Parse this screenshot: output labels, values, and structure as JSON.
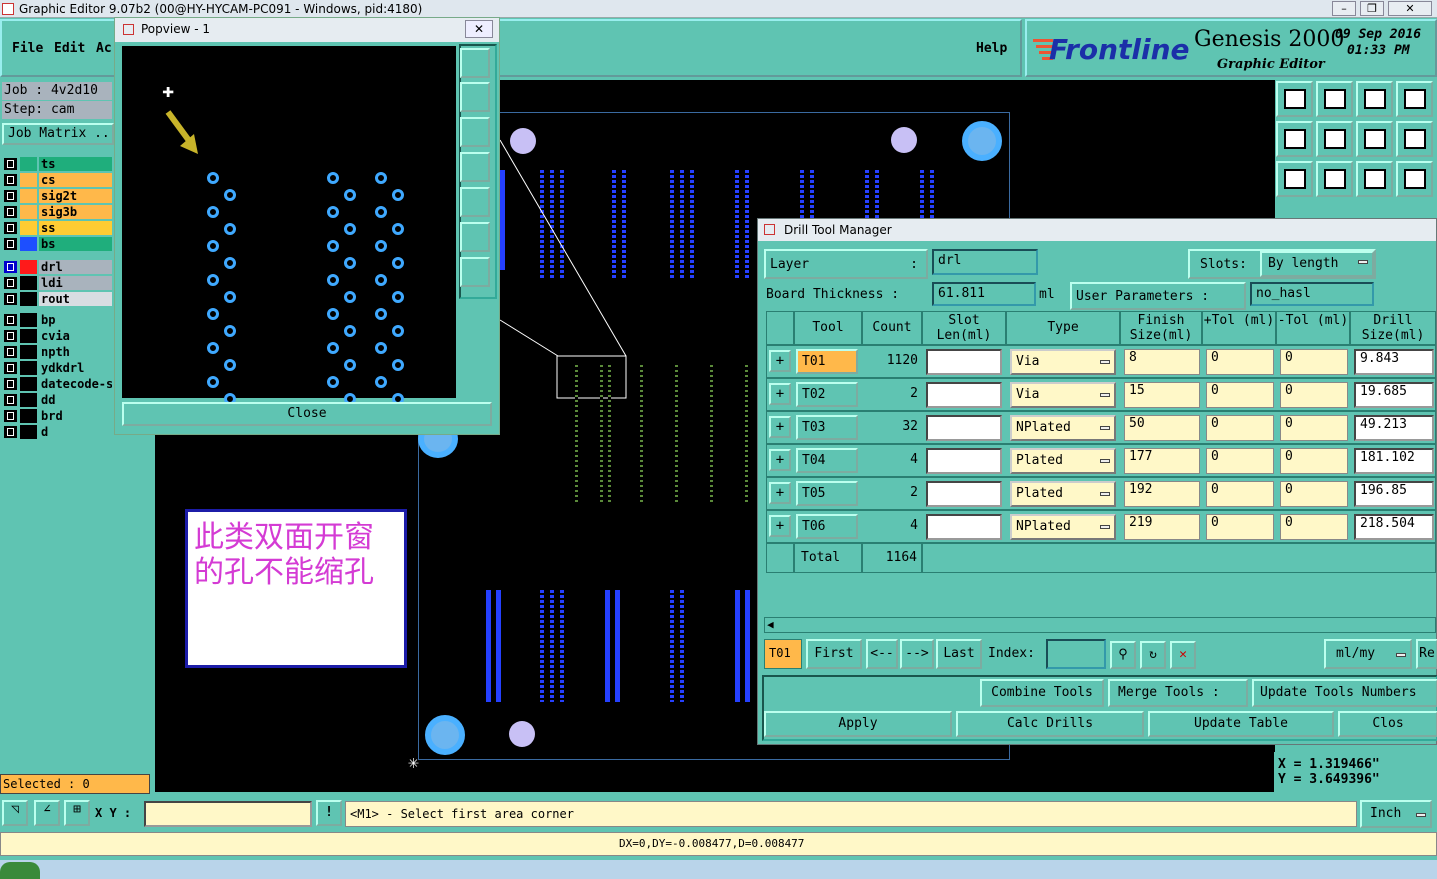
{
  "window": {
    "title": "Graphic Editor 9.07b2 (00@HY-HYCAM-PC091 - Windows, pid:4180)"
  },
  "menu": {
    "file": "File",
    "edit": "Edit",
    "actions": "Ac",
    "help": "Help"
  },
  "brand": {
    "logo": "Frontline",
    "product": "Genesis 2000",
    "subtitle": "Graphic Editor",
    "date": "09 Sep 2016",
    "time": "01:33 PM"
  },
  "job": {
    "job_label": "Job : 4v2d10",
    "step_label": "Step: cam",
    "matrix_button": "Job Matrix ..."
  },
  "layers": [
    {
      "name": "ts",
      "color": "#1fae7c",
      "swatch": "#1fae7c",
      "icon": "#000"
    },
    {
      "name": "cs",
      "color": "#ffb84a",
      "swatch": "#ffb84a",
      "icon": "#000"
    },
    {
      "name": "sig2t",
      "color": "#ffb84a",
      "swatch": "#ffb84a",
      "icon": "#000"
    },
    {
      "name": "sig3b",
      "color": "#ffb84a",
      "swatch": "#ffb84a",
      "icon": "#000"
    },
    {
      "name": "ss",
      "color": "#ffcc33",
      "swatch": "#ffcc33",
      "icon": "#000"
    },
    {
      "name": "bs",
      "color": "#1fae7c",
      "swatch": "#1d4fff",
      "icon": "#000"
    },
    {
      "name": "drl",
      "color": "#a9b3bd",
      "swatch": "#ff1a1a",
      "icon": "#0000cc"
    },
    {
      "name": "ldi",
      "color": "#a9b3bd",
      "swatch": "#000",
      "icon": "#000"
    },
    {
      "name": "rout",
      "color": "#d8dde2",
      "swatch": "#000",
      "icon": "#000"
    },
    {
      "name": "bp",
      "color": "#5fc4b2",
      "swatch": "#000",
      "icon": "#000"
    },
    {
      "name": "cvia",
      "color": "#5fc4b2",
      "swatch": "#000",
      "icon": "#000"
    },
    {
      "name": "npth",
      "color": "#5fc4b2",
      "swatch": "#000",
      "icon": "#000"
    },
    {
      "name": "ydkdrl",
      "color": "#5fc4b2",
      "swatch": "#000",
      "icon": "#000"
    },
    {
      "name": "datecode-s",
      "color": "#5fc4b2",
      "swatch": "#000",
      "icon": "#000"
    },
    {
      "name": "dd",
      "color": "#5fc4b2",
      "swatch": "#000",
      "icon": "#000"
    },
    {
      "name": "brd",
      "color": "#5fc4b2",
      "swatch": "#000",
      "icon": "#000"
    },
    {
      "name": "d",
      "color": "#5fc4b2",
      "swatch": "#000",
      "icon": "#000"
    }
  ],
  "popview": {
    "title": "Popview - 1",
    "close_label": "Close"
  },
  "annotation": {
    "text": "此类双面开窗的孔不能缩孔"
  },
  "dtm": {
    "title": "Drill Tool Manager",
    "layer_label": "Layer",
    "layer_value": "drl",
    "slots_label": "Slots:",
    "slots_value": "By length",
    "board_thickness_label": "Board Thickness :",
    "board_thickness_value": "61.811",
    "board_thickness_unit": "ml",
    "user_params_label": "User Parameters :",
    "user_params_value": "no_hasl",
    "headers": {
      "tool": "Tool",
      "count": "Count",
      "slot_len": "Slot Len(ml)",
      "type": "Type",
      "finish": "Finish Size(ml)",
      "ptol": "+Tol (ml)",
      "mtol": "-Tol (ml)",
      "drill": "Drill Size(ml)"
    },
    "rows": [
      {
        "tool": "T01",
        "count": "1120",
        "type": "Via",
        "finish": "8",
        "ptol": "0",
        "mtol": "0",
        "drill": "9.843",
        "selected": true
      },
      {
        "tool": "T02",
        "count": "2",
        "type": "Via",
        "finish": "15",
        "ptol": "0",
        "mtol": "0",
        "drill": "19.685"
      },
      {
        "tool": "T03",
        "count": "32",
        "type": "NPlated",
        "finish": "50",
        "ptol": "0",
        "mtol": "0",
        "drill": "49.213"
      },
      {
        "tool": "T04",
        "count": "4",
        "type": "Plated",
        "finish": "177",
        "ptol": "0",
        "mtol": "0",
        "drill": "181.102"
      },
      {
        "tool": "T05",
        "count": "2",
        "type": "Plated",
        "finish": "192",
        "ptol": "0",
        "mtol": "0",
        "drill": "196.85"
      },
      {
        "tool": "T06",
        "count": "4",
        "type": "NPlated",
        "finish": "219",
        "ptol": "0",
        "mtol": "0",
        "drill": "218.504"
      }
    ],
    "total_label": "Total",
    "total_value": "1164",
    "nav": {
      "current": "T01",
      "first": "First",
      "prev": "<--",
      "next": "-->",
      "last": "Last",
      "index_label": "Index:",
      "units": "ml/my",
      "re": "Re"
    },
    "actions": {
      "combine": "Combine Tools",
      "merge": "Merge Tools :",
      "update_numbers": "Update Tools Numbers",
      "apply": "Apply",
      "calc": "Calc Drills",
      "update_table": "Update Table",
      "close": "Clos"
    }
  },
  "status": {
    "selected": "Selected : 0",
    "xy_label": "X Y :",
    "prompt": "<M1> - Select first area corner",
    "units": "Inch",
    "coord_x": "X = 1.319466\"",
    "coord_y": "Y = 3.649396\"",
    "delta": "DX=0,DY=-0.008477,D=0.008477"
  }
}
